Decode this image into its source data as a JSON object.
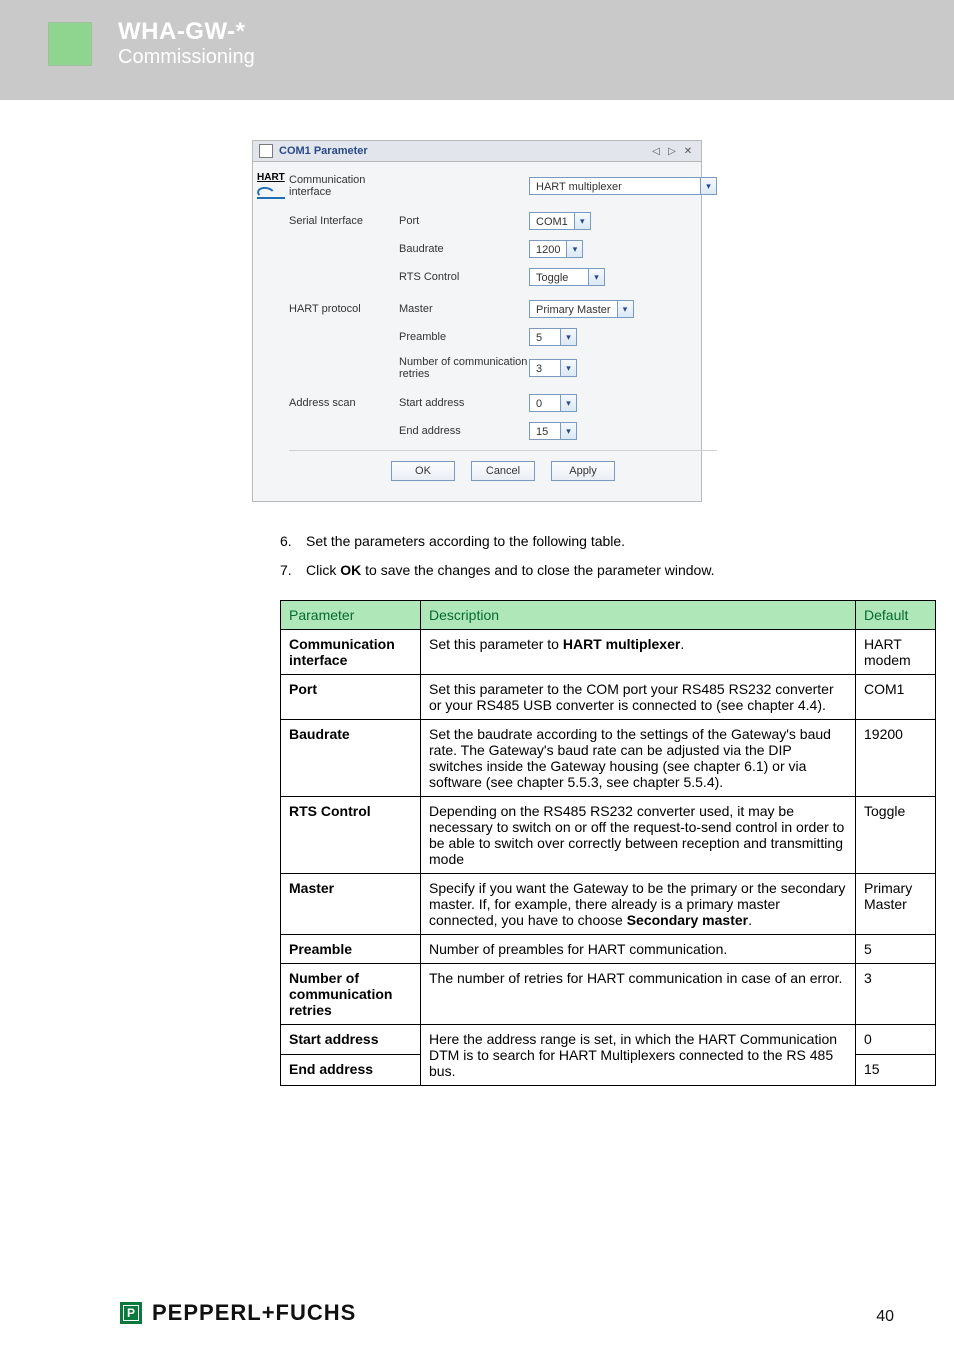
{
  "header": {
    "title": "WHA-GW-*",
    "subtitle": "Commissioning"
  },
  "panel": {
    "hart_label": "HART",
    "window_title": "COM1 Parameter",
    "prev_glyph": "◁",
    "next_glyph": "▷",
    "close_glyph": "✕",
    "groups": {
      "comm_interface": {
        "label": "Communication interface",
        "value": "HART multiplexer"
      },
      "serial": {
        "label": "Serial Interface",
        "port_label": "Port",
        "port_value": "COM1",
        "baud_label": "Baudrate",
        "baud_value": "1200",
        "rts_label": "RTS Control",
        "rts_value": "Toggle"
      },
      "hart": {
        "label": "HART protocol",
        "master_label": "Master",
        "master_value": "Primary Master",
        "preamble_label": "Preamble",
        "preamble_value": "5",
        "retries_label": "Number of communication retries",
        "retries_value": "3"
      },
      "scan": {
        "label": "Address scan",
        "start_label": "Start address",
        "start_value": "0",
        "end_label": "End address",
        "end_value": "15"
      }
    },
    "buttons": {
      "ok": "OK",
      "cancel": "Cancel",
      "apply": "Apply"
    }
  },
  "list": {
    "n6": "6.",
    "t6": "Set the parameters according to the following table.",
    "n7": "7.",
    "t7_a": "Click ",
    "t7_b": "OK",
    "t7_c": " to save the changes and to close the parameter window."
  },
  "table": {
    "head": {
      "param": "Parameter",
      "desc": "Description",
      "def": "Default"
    },
    "rows": {
      "ci": {
        "param": "Communication interface",
        "desc_a": "Set this parameter to ",
        "desc_b": "HART multiplexer",
        "desc_c": ".",
        "def": "HART modem"
      },
      "port": {
        "param": "Port",
        "desc": "Set this parameter to the COM port your RS485  RS232 converter or your RS485  USB converter is connected to (see chapter 4.4).",
        "def": "COM1"
      },
      "baud": {
        "param": "Baudrate",
        "desc": "Set the baudrate according to the settings of the Gateway's baud rate. The Gateway's baud rate can be adjusted via the DIP switches inside the Gateway housing (see chapter 6.1) or via software (see chapter 5.5.3, see chapter 5.5.4).",
        "def": "19200"
      },
      "rts": {
        "param": "RTS Control",
        "desc": "Depending on the RS485  RS232 converter used, it may be necessary to switch on or off the request-to-send control in order to be able to switch over correctly between reception and transmitting mode",
        "def": "Toggle"
      },
      "mas": {
        "param": "Master",
        "desc_a": "Specify if you want the Gateway to be the primary or the secondary master. If, for example, there already is a primary master connected, you have to choose ",
        "desc_b": "Secondary master",
        "desc_c": ".",
        "def": "Primary Master"
      },
      "pre": {
        "param": "Preamble",
        "desc": "Number of preambles for HART communication.",
        "def": "5"
      },
      "ret": {
        "param": "Number of communication retries",
        "desc": "The number of retries for HART communication in case of an error.",
        "def": "3"
      },
      "sa": {
        "param": "Start address",
        "def": "0"
      },
      "ea": {
        "param": "End address",
        "desc": "Here the address range is set, in which the HART Communication DTM is to search for HART Multiplexers connected to the RS 485 bus.",
        "def": "15"
      }
    }
  },
  "footer": {
    "brand": "PEPPERL+FUCHS",
    "page": "40"
  }
}
